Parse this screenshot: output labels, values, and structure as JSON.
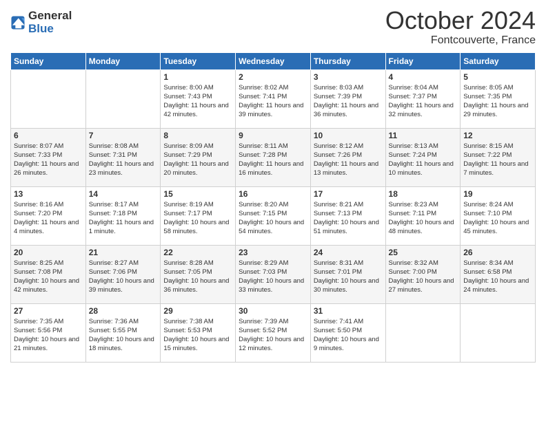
{
  "logo": {
    "general": "General",
    "blue": "Blue"
  },
  "header": {
    "month": "October 2024",
    "location": "Fontcouverte, France"
  },
  "weekdays": [
    "Sunday",
    "Monday",
    "Tuesday",
    "Wednesday",
    "Thursday",
    "Friday",
    "Saturday"
  ],
  "weeks": [
    [
      {
        "day": "",
        "info": ""
      },
      {
        "day": "",
        "info": ""
      },
      {
        "day": "1",
        "info": "Sunrise: 8:00 AM\nSunset: 7:43 PM\nDaylight: 11 hours and 42 minutes."
      },
      {
        "day": "2",
        "info": "Sunrise: 8:02 AM\nSunset: 7:41 PM\nDaylight: 11 hours and 39 minutes."
      },
      {
        "day": "3",
        "info": "Sunrise: 8:03 AM\nSunset: 7:39 PM\nDaylight: 11 hours and 36 minutes."
      },
      {
        "day": "4",
        "info": "Sunrise: 8:04 AM\nSunset: 7:37 PM\nDaylight: 11 hours and 32 minutes."
      },
      {
        "day": "5",
        "info": "Sunrise: 8:05 AM\nSunset: 7:35 PM\nDaylight: 11 hours and 29 minutes."
      }
    ],
    [
      {
        "day": "6",
        "info": "Sunrise: 8:07 AM\nSunset: 7:33 PM\nDaylight: 11 hours and 26 minutes."
      },
      {
        "day": "7",
        "info": "Sunrise: 8:08 AM\nSunset: 7:31 PM\nDaylight: 11 hours and 23 minutes."
      },
      {
        "day": "8",
        "info": "Sunrise: 8:09 AM\nSunset: 7:29 PM\nDaylight: 11 hours and 20 minutes."
      },
      {
        "day": "9",
        "info": "Sunrise: 8:11 AM\nSunset: 7:28 PM\nDaylight: 11 hours and 16 minutes."
      },
      {
        "day": "10",
        "info": "Sunrise: 8:12 AM\nSunset: 7:26 PM\nDaylight: 11 hours and 13 minutes."
      },
      {
        "day": "11",
        "info": "Sunrise: 8:13 AM\nSunset: 7:24 PM\nDaylight: 11 hours and 10 minutes."
      },
      {
        "day": "12",
        "info": "Sunrise: 8:15 AM\nSunset: 7:22 PM\nDaylight: 11 hours and 7 minutes."
      }
    ],
    [
      {
        "day": "13",
        "info": "Sunrise: 8:16 AM\nSunset: 7:20 PM\nDaylight: 11 hours and 4 minutes."
      },
      {
        "day": "14",
        "info": "Sunrise: 8:17 AM\nSunset: 7:18 PM\nDaylight: 11 hours and 1 minute."
      },
      {
        "day": "15",
        "info": "Sunrise: 8:19 AM\nSunset: 7:17 PM\nDaylight: 10 hours and 58 minutes."
      },
      {
        "day": "16",
        "info": "Sunrise: 8:20 AM\nSunset: 7:15 PM\nDaylight: 10 hours and 54 minutes."
      },
      {
        "day": "17",
        "info": "Sunrise: 8:21 AM\nSunset: 7:13 PM\nDaylight: 10 hours and 51 minutes."
      },
      {
        "day": "18",
        "info": "Sunrise: 8:23 AM\nSunset: 7:11 PM\nDaylight: 10 hours and 48 minutes."
      },
      {
        "day": "19",
        "info": "Sunrise: 8:24 AM\nSunset: 7:10 PM\nDaylight: 10 hours and 45 minutes."
      }
    ],
    [
      {
        "day": "20",
        "info": "Sunrise: 8:25 AM\nSunset: 7:08 PM\nDaylight: 10 hours and 42 minutes."
      },
      {
        "day": "21",
        "info": "Sunrise: 8:27 AM\nSunset: 7:06 PM\nDaylight: 10 hours and 39 minutes."
      },
      {
        "day": "22",
        "info": "Sunrise: 8:28 AM\nSunset: 7:05 PM\nDaylight: 10 hours and 36 minutes."
      },
      {
        "day": "23",
        "info": "Sunrise: 8:29 AM\nSunset: 7:03 PM\nDaylight: 10 hours and 33 minutes."
      },
      {
        "day": "24",
        "info": "Sunrise: 8:31 AM\nSunset: 7:01 PM\nDaylight: 10 hours and 30 minutes."
      },
      {
        "day": "25",
        "info": "Sunrise: 8:32 AM\nSunset: 7:00 PM\nDaylight: 10 hours and 27 minutes."
      },
      {
        "day": "26",
        "info": "Sunrise: 8:34 AM\nSunset: 6:58 PM\nDaylight: 10 hours and 24 minutes."
      }
    ],
    [
      {
        "day": "27",
        "info": "Sunrise: 7:35 AM\nSunset: 5:56 PM\nDaylight: 10 hours and 21 minutes."
      },
      {
        "day": "28",
        "info": "Sunrise: 7:36 AM\nSunset: 5:55 PM\nDaylight: 10 hours and 18 minutes."
      },
      {
        "day": "29",
        "info": "Sunrise: 7:38 AM\nSunset: 5:53 PM\nDaylight: 10 hours and 15 minutes."
      },
      {
        "day": "30",
        "info": "Sunrise: 7:39 AM\nSunset: 5:52 PM\nDaylight: 10 hours and 12 minutes."
      },
      {
        "day": "31",
        "info": "Sunrise: 7:41 AM\nSunset: 5:50 PM\nDaylight: 10 hours and 9 minutes."
      },
      {
        "day": "",
        "info": ""
      },
      {
        "day": "",
        "info": ""
      }
    ]
  ]
}
